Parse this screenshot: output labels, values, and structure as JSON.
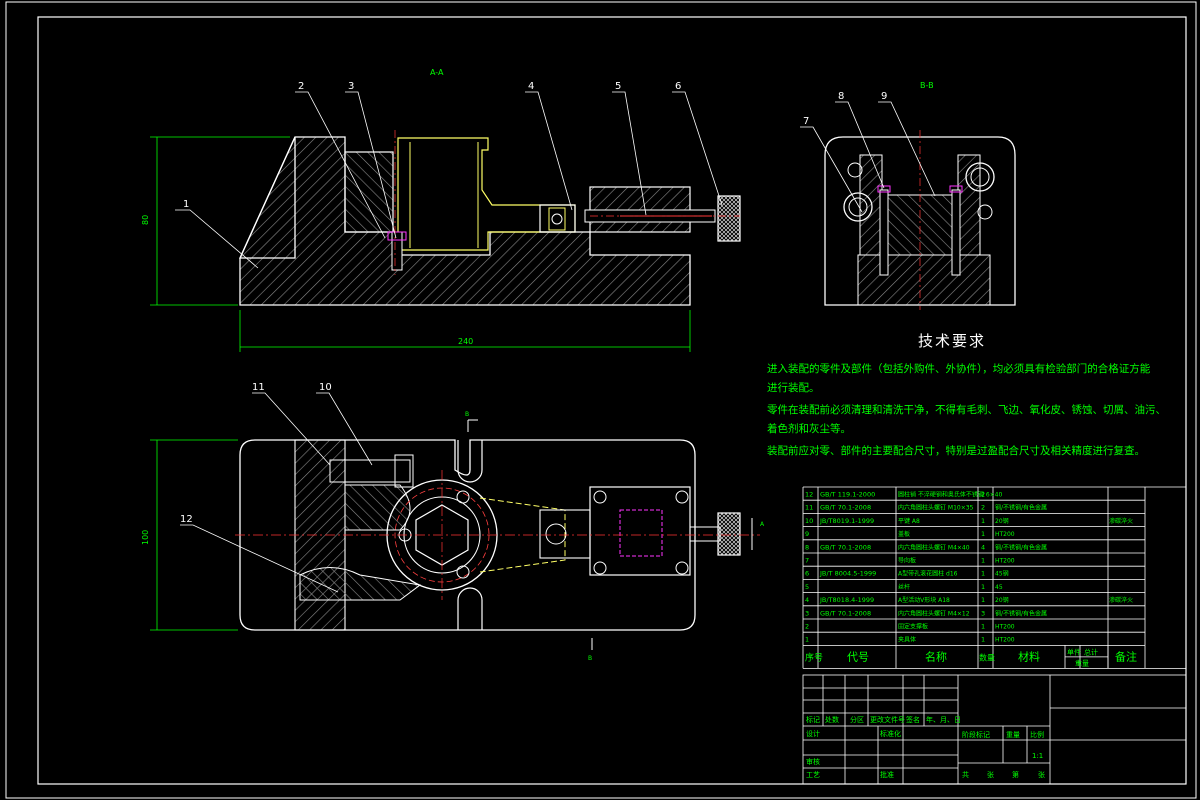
{
  "views": {
    "section_a_label": "A-A",
    "section_b_label": "B-B",
    "section_a_marker": "A",
    "section_b_marker": "B"
  },
  "dimensions": {
    "height_front": "80",
    "width_front": "240",
    "height_top": "100"
  },
  "balloons": [
    "1",
    "2",
    "3",
    "4",
    "5",
    "6",
    "7",
    "8",
    "9",
    "10",
    "11",
    "12"
  ],
  "requirements": {
    "title": "技术要求",
    "lines": [
      "进入装配的零件及部件（包括外购件、外协件），均必须具有检验部门的合格证方能",
      "进行装配。",
      "零件在装配前必须清理和清洗干净，不得有毛刺、飞边、氧化皮、锈蚀、切屑、油污、",
      "着色剂和灰尘等。",
      "装配前应对零、部件的主要配合尺寸，特别是过盈配合尺寸及相关精度进行复查。"
    ]
  },
  "bom": {
    "rows": [
      {
        "no": "12",
        "code": "GB/T 119.1-2000",
        "name": "圆柱销 不淬硬钢和奥氏体不锈钢 6×40",
        "qty": "2",
        "material": "",
        "note": ""
      },
      {
        "no": "11",
        "code": "GB/T 70.1-2008",
        "name": "内六角圆柱头螺钉 M10×35",
        "qty": "2",
        "material": "钢/不锈钢/有色金属",
        "note": ""
      },
      {
        "no": "10",
        "code": "JB/T8019.1-1999",
        "name": "平键 A8",
        "qty": "1",
        "material": "20钢",
        "note": "渗碳淬火"
      },
      {
        "no": "9",
        "code": "",
        "name": "盖板",
        "qty": "1",
        "material": "HT200",
        "note": ""
      },
      {
        "no": "8",
        "code": "GB/T 70.1-2008",
        "name": "内六角圆柱头螺钉 M4×40",
        "qty": "4",
        "material": "钢/不锈钢/有色金属",
        "note": ""
      },
      {
        "no": "7",
        "code": "",
        "name": "导向板",
        "qty": "1",
        "material": "HT200",
        "note": ""
      },
      {
        "no": "6",
        "code": "JB/T 8004.5-1999",
        "name": "A型带孔滚花圆柱 d16",
        "qty": "1",
        "material": "45钢",
        "note": ""
      },
      {
        "no": "5",
        "code": "",
        "name": "丝杆",
        "qty": "1",
        "material": "45",
        "note": ""
      },
      {
        "no": "4",
        "code": "JB/T8018.4-1999",
        "name": "A型活动V形块 A18",
        "qty": "1",
        "material": "20钢",
        "note": "渗碳淬火"
      },
      {
        "no": "3",
        "code": "GB/T 70.1-2008",
        "name": "内六角圆柱头螺钉 M4×12",
        "qty": "3",
        "material": "钢/不锈钢/有色金属",
        "note": ""
      },
      {
        "no": "2",
        "code": "",
        "name": "固定支撑板",
        "qty": "1",
        "material": "HT200",
        "note": ""
      },
      {
        "no": "1",
        "code": "",
        "name": "夹具体",
        "qty": "1",
        "material": "HT200",
        "note": ""
      }
    ],
    "header": {
      "no": "序号",
      "code": "代号",
      "name": "名称",
      "qty": "数量",
      "material": "材料",
      "single": "单件",
      "total": "总计",
      "weight": "重量",
      "note": "备注"
    }
  },
  "title_block": {
    "mark": "标记",
    "count": "处数",
    "zone": "分区",
    "change_doc": "更改文件号",
    "signature": "签名",
    "date": "年、月、日",
    "design": "设计",
    "standardize": "标准化",
    "review": "审核",
    "process": "工艺",
    "approve": "批准",
    "stage_mark": "阶段标记",
    "weight": "重量",
    "scale": "比例",
    "scale_value": "1:1",
    "sheets_total": "共",
    "sheet_unit_total": "张",
    "sheet_no": "第",
    "sheet_unit": "张"
  },
  "colors": {
    "background": "#000000",
    "outline": "#ffffff",
    "dimension": "#00ff00",
    "hatch": "#7a7a7a",
    "part_yellow": "#ffff66",
    "part_red": "#ff4040",
    "part_magenta": "#ff33ff",
    "centerline": "#ff3333"
  }
}
